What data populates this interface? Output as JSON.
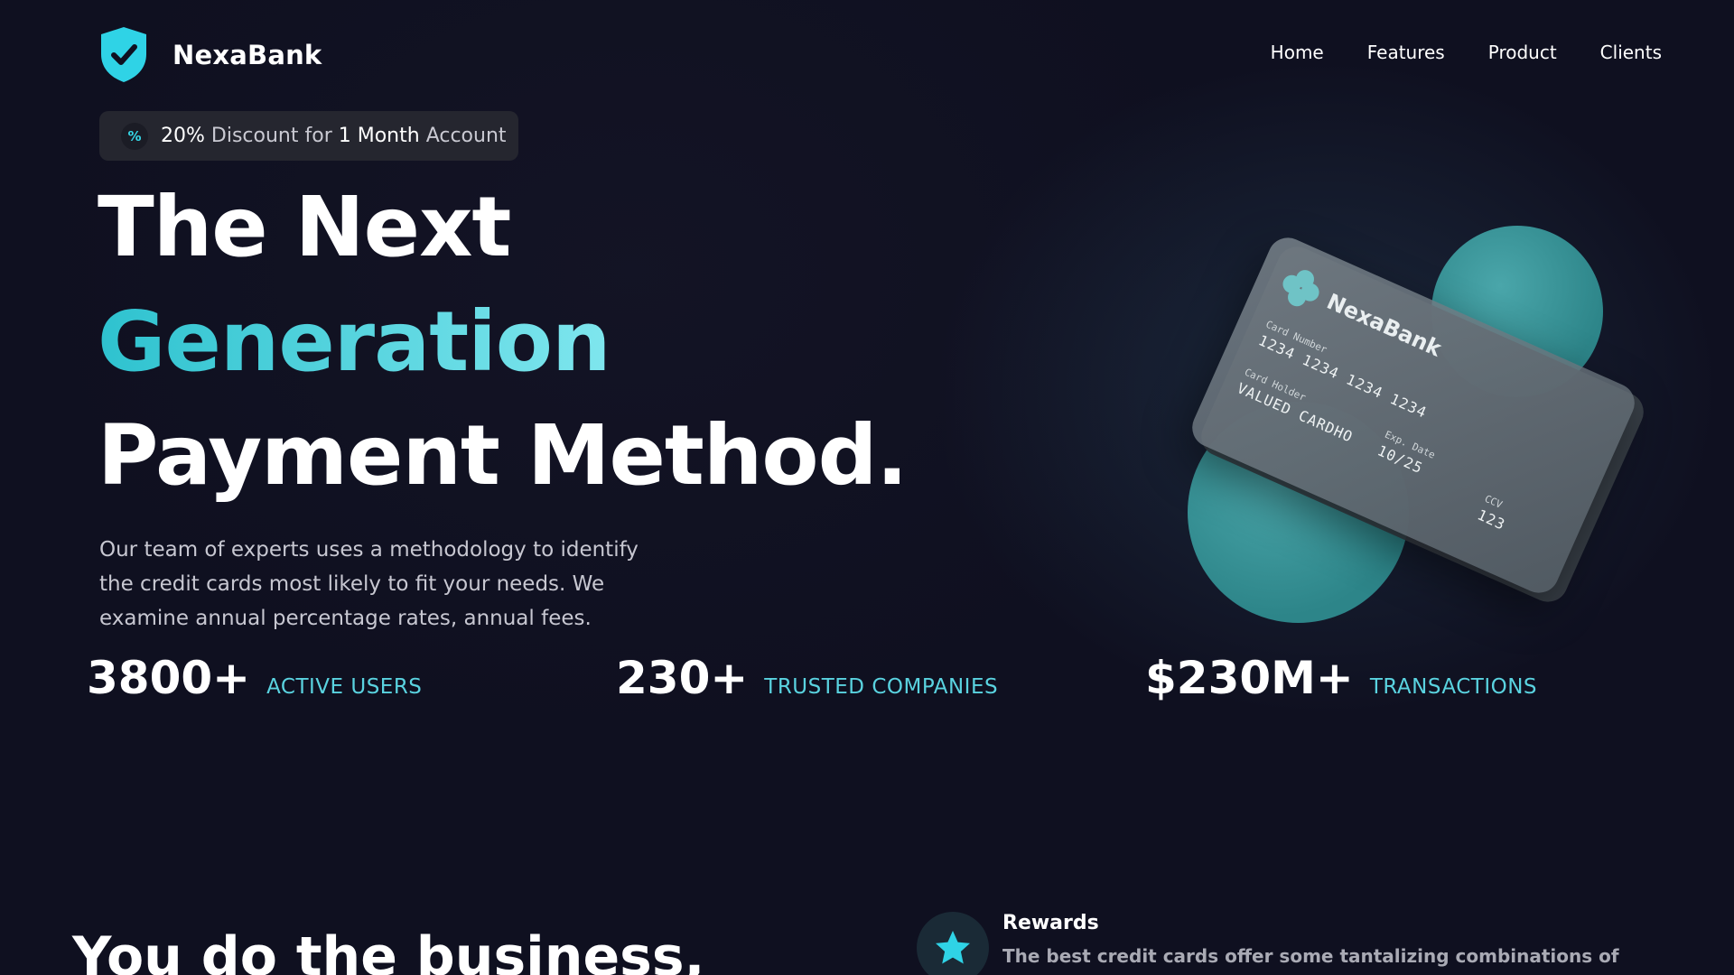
{
  "brand": {
    "name": "NexaBank",
    "logo_icon": "shield-check-icon",
    "accent_color": "#35d6e6"
  },
  "nav": {
    "items": [
      {
        "label": "Home"
      },
      {
        "label": "Features"
      },
      {
        "label": "Product"
      },
      {
        "label": "Clients"
      }
    ]
  },
  "promo": {
    "icon": "percent-icon",
    "icon_glyph": "%",
    "percent": "20%",
    "text_a": "Discount for",
    "month_text": "1 Month",
    "text_b": "Account"
  },
  "hero": {
    "line1": "The Next",
    "line2": "Generation",
    "line3": "Payment Method.",
    "description": "Our team of experts uses a methodology to identify the credit cards most likely to fit your needs. We examine annual percentage rates, annual fees."
  },
  "stats": [
    {
      "value": "3800+",
      "label": "ACTIVE USERS"
    },
    {
      "value": "230+",
      "label": "TRUSTED COMPANIES"
    },
    {
      "value": "$230M+",
      "label": "TRANSACTIONS"
    }
  ],
  "card": {
    "brand": "NexaBank",
    "number_label": "Card Number",
    "number": "1234 1234 1234 1234",
    "holder_label": "Card Holder",
    "holder": "VALUED CARDHO",
    "exp_label": "Exp. Date",
    "exp": "10/25",
    "ccv_label": "CCV",
    "ccv": "123"
  },
  "section2": {
    "title": "You do the business,"
  },
  "feature": {
    "icon": "star-icon",
    "title": "Rewards",
    "description": "The best credit cards offer some tantalizing combinations of"
  }
}
